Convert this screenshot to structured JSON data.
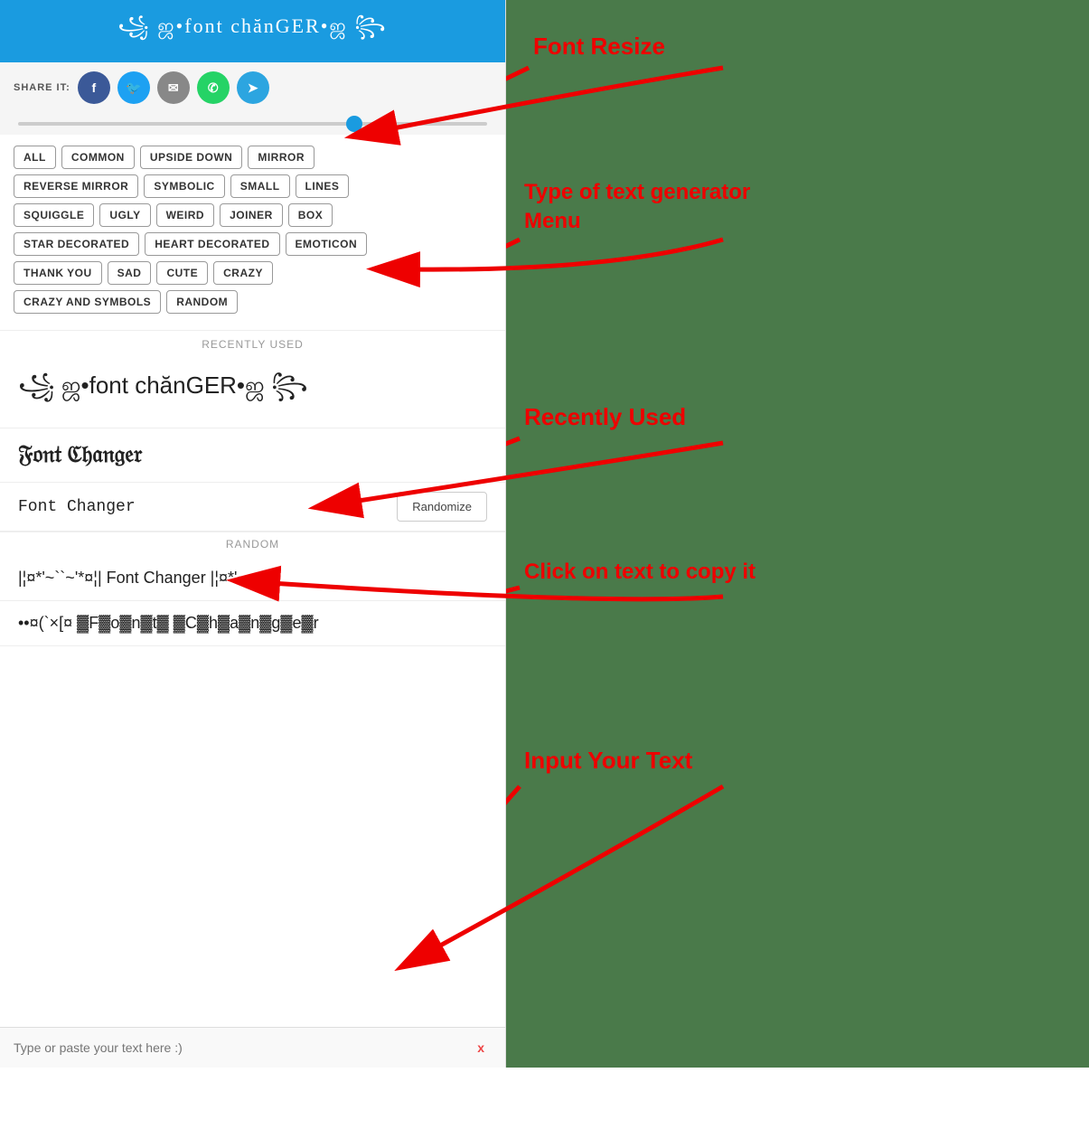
{
  "header": {
    "title": "꧁ ஜ•font сhănGER•ஜ ꧂",
    "background": "#1a9be0"
  },
  "share": {
    "label": "SHARE IT:",
    "buttons": [
      {
        "name": "facebook",
        "symbol": "f",
        "color": "#3b5998"
      },
      {
        "name": "twitter",
        "symbol": "t",
        "color": "#1da1f2"
      },
      {
        "name": "email",
        "symbol": "✉",
        "color": "#888"
      },
      {
        "name": "whatsapp",
        "symbol": "w",
        "color": "#25d366"
      },
      {
        "name": "telegram",
        "symbol": "➤",
        "color": "#2ca5e0"
      }
    ]
  },
  "tags": [
    [
      "ALL",
      "COMMON",
      "UPSIDE DOWN",
      "MIRROR"
    ],
    [
      "REVERSE MIRROR",
      "SYMBOLIC",
      "SMALL",
      "LINES"
    ],
    [
      "SQUIGGLE",
      "UGLY",
      "WEIRD",
      "JOINER",
      "BOX"
    ],
    [
      "STAR DECORATED",
      "HEART DECORATED",
      "EMOTICON"
    ],
    [
      "THANK YOU",
      "SAD",
      "CUTE",
      "CRAZY"
    ],
    [
      "CRAZY AND SYMBOLS",
      "RANDOM"
    ]
  ],
  "recently_used_label": "RECENTLY USED",
  "results": [
    {
      "text": "꧁ ஜ•font сhănGER•ஜ ꧂",
      "style": "fancy1"
    },
    {
      "text": "𝔉𝔬𝔫𝔱 ℭ𝔥𝔞𝔫𝔤𝔢𝔯",
      "style": "fancy2"
    },
    {
      "text": "Font Changer",
      "style": "fancy3"
    },
    {
      "text": "Randomize",
      "style": "button"
    }
  ],
  "section_random": "RANDOM",
  "random_results": [
    {
      "text": "|¦¤*'~``~'*¤¦| Font Changer |¦¤*'~"
    },
    {
      "text": "••¤(`×[¤ ▓F▓o▓n▓t▓ ▓C▓h▓a▓n▓g▓e▓r ▓"
    }
  ],
  "input": {
    "placeholder": "Type or paste your text here :)",
    "clear_label": "x"
  },
  "annotations": {
    "font_resize": "Font Resize",
    "type_of_generator": "Type of text generator\nMenu",
    "recently_used": "Recently Used",
    "click_to_copy": "Click on text to copy it",
    "input_your_text": "Input Your Text"
  }
}
